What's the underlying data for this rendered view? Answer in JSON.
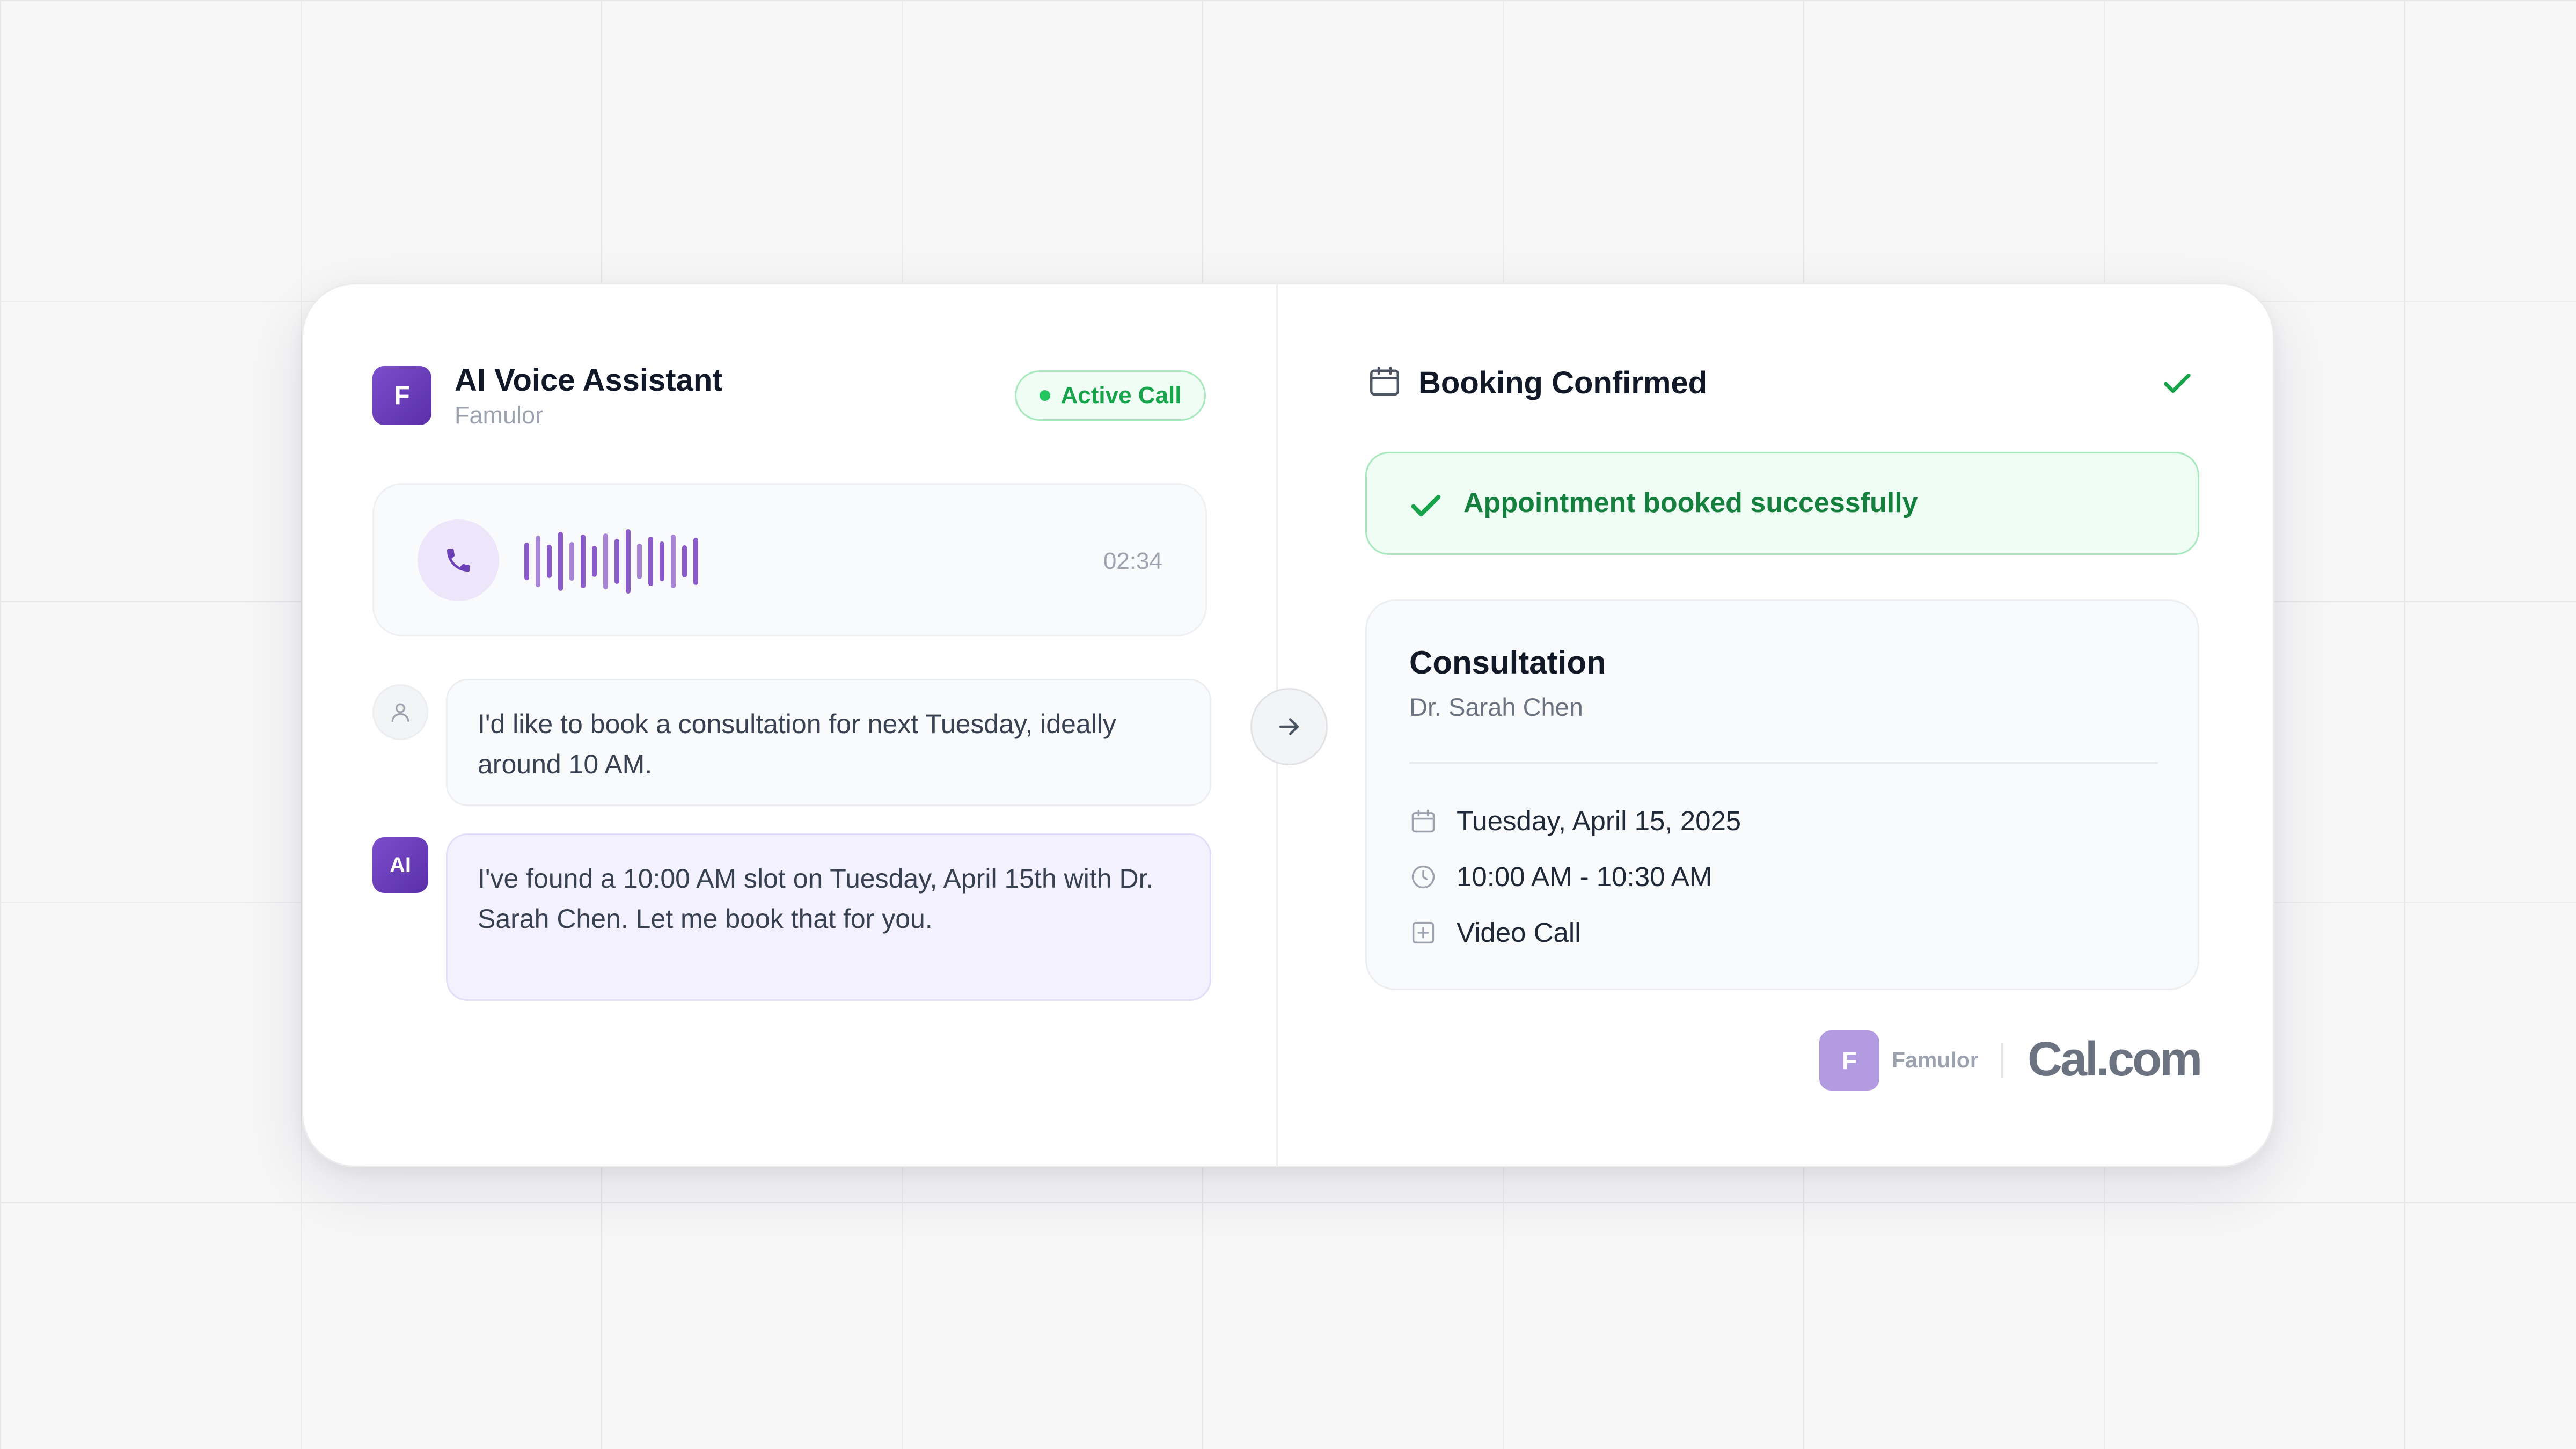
{
  "assistant": {
    "logo_letter": "F",
    "title": "AI Voice Assistant",
    "subtitle": "Famulor",
    "status_badge": "Active Call"
  },
  "call": {
    "timer": "02:34",
    "icon": "phone-icon"
  },
  "conversation": [
    {
      "speaker": "user",
      "avatar_icon": "user-icon",
      "text": "I'd like to book a consultation for next Tuesday, ideally around 10 AM."
    },
    {
      "speaker": "ai",
      "avatar_label": "AI",
      "text": "I've found a 10:00 AM slot on Tuesday, April 15th with Dr. Sarah Chen. Let me book that for you."
    }
  ],
  "booking": {
    "title": "Booking Confirmed",
    "success_message": "Appointment booked successfully",
    "appointment": {
      "type": "Consultation",
      "provider": "Dr. Sarah Chen",
      "date": "Tuesday, April 15, 2025",
      "time": "10:00 AM - 10:30 AM",
      "location": "Video Call"
    }
  },
  "footer": {
    "famulor_logo_letter": "F",
    "famulor_label": "Famulor",
    "cal_label": "Cal.com"
  },
  "colors": {
    "brand_purple": "#6b3fb8",
    "success_green": "#16a34a",
    "success_bg": "#f0fdf4"
  }
}
